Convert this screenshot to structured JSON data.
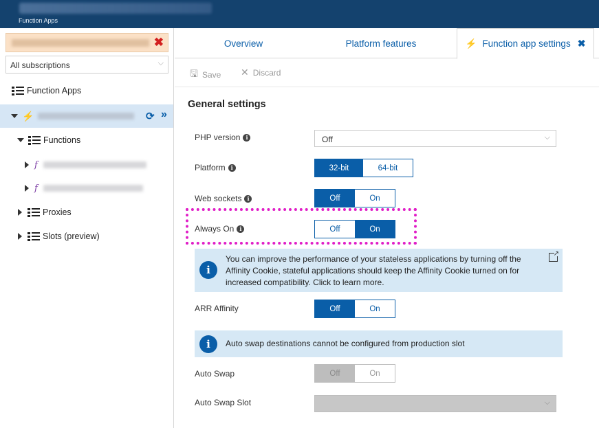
{
  "topbar": {
    "breadcrumb": "Function Apps"
  },
  "left": {
    "subscription_filter": "All subscriptions",
    "tree": {
      "root_label": "Function Apps",
      "functions_label": "Functions",
      "proxies_label": "Proxies",
      "slots_label": "Slots (preview)"
    }
  },
  "tabs": [
    {
      "label": "Overview"
    },
    {
      "label": "Platform features"
    },
    {
      "label": "Function app settings"
    }
  ],
  "toolbar": {
    "save_label": "Save",
    "discard_label": "Discard"
  },
  "section": {
    "title": "General settings"
  },
  "settings": {
    "php_version": {
      "label": "PHP version",
      "value": "Off"
    },
    "platform": {
      "label": "Platform",
      "options": [
        "32-bit",
        "64-bit"
      ],
      "selected": "32-bit"
    },
    "web_sockets": {
      "label": "Web sockets",
      "options": [
        "Off",
        "On"
      ],
      "selected": "Off"
    },
    "always_on": {
      "label": "Always On",
      "options": [
        "Off",
        "On"
      ],
      "selected": "On"
    },
    "affinity_info": "You can improve the performance of your stateless applications by turning off the Affinity Cookie, stateful applications should keep the Affinity Cookie turned on for increased compatibility. Click to learn more.",
    "arr_affinity": {
      "label": "ARR Affinity",
      "options": [
        "Off",
        "On"
      ],
      "selected": "Off"
    },
    "swap_info": "Auto swap destinations cannot be configured from production slot",
    "auto_swap": {
      "label": "Auto Swap",
      "options": [
        "Off",
        "On"
      ],
      "selected": "Off",
      "disabled": true
    },
    "auto_swap_slot": {
      "label": "Auto Swap Slot",
      "value": "",
      "disabled": true
    }
  },
  "colors": {
    "accent": "#0a5ea8",
    "topbar": "#14426e",
    "highlight": "#e01ec7",
    "info_bg": "#d6e8f5"
  },
  "icons": [
    "lightning-icon",
    "list-icon",
    "refresh-icon",
    "double-chevron-icon",
    "info-icon",
    "external-link-icon",
    "save-icon",
    "discard-icon"
  ]
}
